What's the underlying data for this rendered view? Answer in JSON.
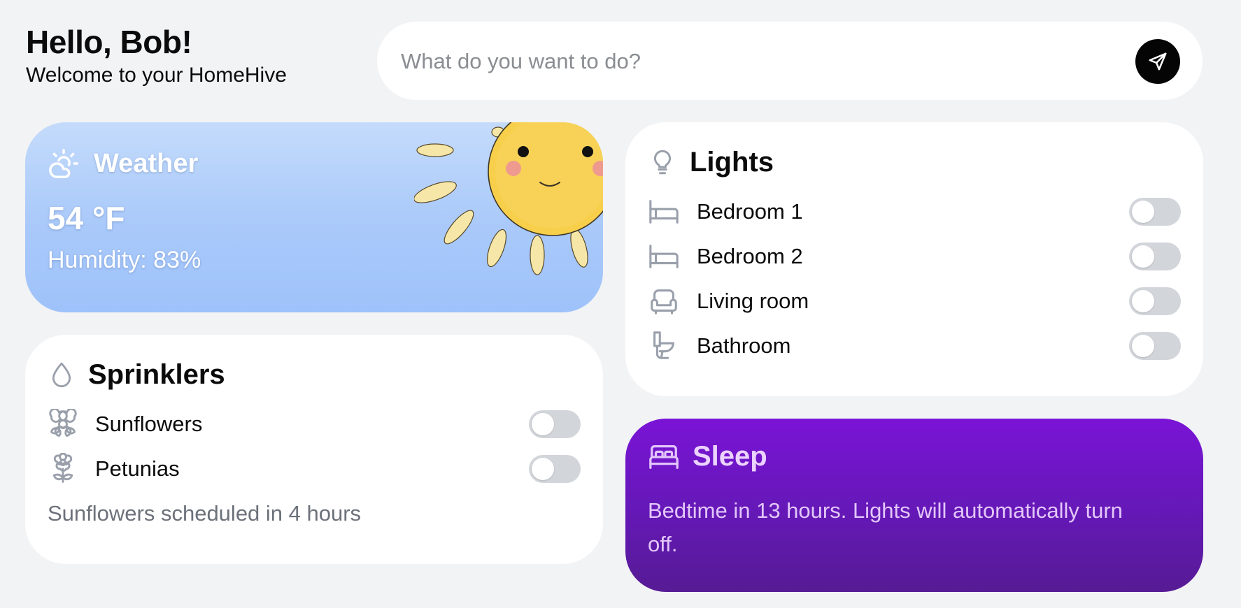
{
  "header": {
    "greeting": "Hello, Bob!",
    "subtitle": "Welcome to your HomeHive"
  },
  "command": {
    "placeholder": "What do you want to do?",
    "send_icon": "send-icon"
  },
  "weather": {
    "title": "Weather",
    "temperature": "54 °F",
    "humidity": "Humidity: 83%",
    "icon": "cloud-sun-icon",
    "illustration": "sun-illustration"
  },
  "lights": {
    "title": "Lights",
    "icon": "lightbulb-icon",
    "items": [
      {
        "label": "Bedroom 1",
        "icon": "bed-icon",
        "on": false
      },
      {
        "label": "Bedroom 2",
        "icon": "bed-icon",
        "on": false
      },
      {
        "label": "Living room",
        "icon": "armchair-icon",
        "on": false
      },
      {
        "label": "Bathroom",
        "icon": "toilet-icon",
        "on": false
      }
    ]
  },
  "sprinklers": {
    "title": "Sprinklers",
    "icon": "droplet-icon",
    "items": [
      {
        "label": "Sunflowers",
        "icon": "flower-icon",
        "on": false
      },
      {
        "label": "Petunias",
        "icon": "flower-stem-icon",
        "on": false
      }
    ],
    "note": "Sunflowers scheduled in 4 hours"
  },
  "sleep": {
    "title": "Sleep",
    "icon": "bed-double-icon",
    "description": "Bedtime in 13 hours. Lights will automatically turn off."
  },
  "colors": {
    "background": "#f2f3f5",
    "toggle_off": "#d2d5da",
    "icon_gray": "#9aa0ab",
    "sleep_purple": "#6a18c0",
    "weather_blue": "#a9c9fa"
  }
}
